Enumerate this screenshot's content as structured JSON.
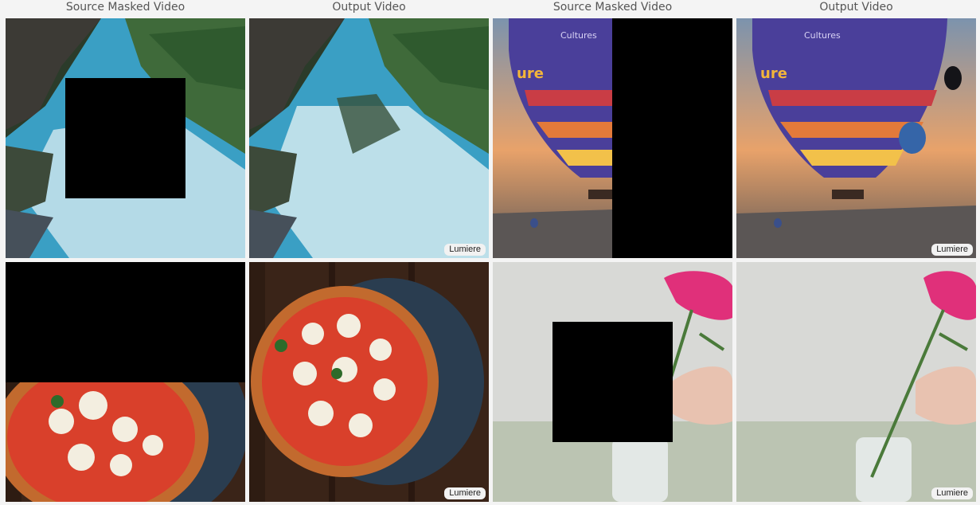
{
  "headers": {
    "col1": "Source Masked Video",
    "col2": "Output Video",
    "col3": "Source Masked Video",
    "col4": "Output Video"
  },
  "badges": {
    "river_output": "Lumiere",
    "balloon_output": "Lumiere",
    "pizza_output": "Lumiere",
    "flower_output": "Lumiere"
  },
  "balloon_text": "Cultures",
  "colors": {
    "mask": "#000000",
    "river_water": "#3a9fc4",
    "balloon_sky": "#e8a26a",
    "pizza_board": "#2a3d50",
    "flower_pink": "#e0307a"
  }
}
